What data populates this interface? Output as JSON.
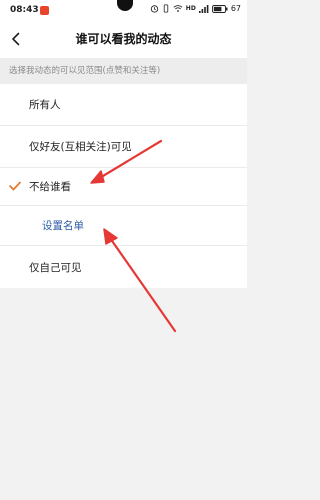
{
  "status_bar": {
    "time": "08:43",
    "network_label": "HD",
    "battery": "67"
  },
  "nav": {
    "title": "谁可以看我的动态",
    "back_icon": "chevron-left-icon"
  },
  "section_hint": "选择我动态的可以见范围(点赞和关注等)",
  "options": [
    {
      "label": "所有人",
      "selected": false
    },
    {
      "label": "仅好友(互相关注)可见",
      "selected": false
    },
    {
      "label": "不给谁看",
      "selected": true
    },
    {
      "label": "设置名单",
      "sub": true
    },
    {
      "label": "仅自己可见",
      "selected": false
    }
  ],
  "colors": {
    "check": "#e8792a",
    "link": "#2c5da8",
    "arrow": "#e53935",
    "notification": "#e8452c"
  }
}
